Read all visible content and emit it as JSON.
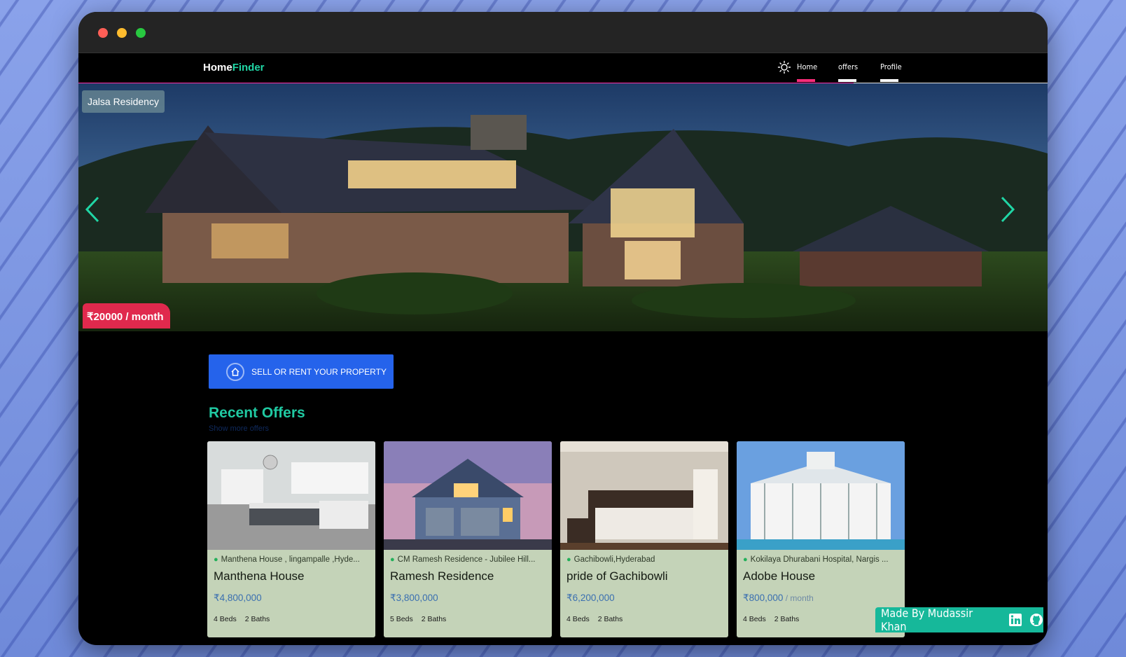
{
  "window": {
    "controls": [
      "close",
      "minimize",
      "maximize"
    ]
  },
  "brand": {
    "part1": "Home",
    "part2": "Finder"
  },
  "nav": {
    "theme_icon": "sun-icon",
    "links": [
      {
        "label": "Home",
        "underline_color": "#ff2d7a"
      },
      {
        "label": "offers",
        "underline_color": "#ffffff"
      },
      {
        "label": "Profile",
        "underline_color": "#ffffff"
      }
    ]
  },
  "hero": {
    "label": "Jalsa Residency",
    "price": "₹20000 / month"
  },
  "cta": {
    "label": "SELL OR RENT YOUR PROPERTY",
    "icon": "home-icon"
  },
  "recent": {
    "title": "Recent Offers",
    "show_more": "Show more offers",
    "cards": [
      {
        "location": "Manthena House , lingampalle ,Hyde...",
        "title": "Manthena House",
        "price": "₹4,800,000",
        "per": "",
        "beds": "4 Beds",
        "baths": "2 Baths"
      },
      {
        "location": "CM Ramesh Residence - Jubilee Hill...",
        "title": "Ramesh Residence",
        "price": "₹3,800,000",
        "per": "",
        "beds": "5 Beds",
        "baths": "2 Baths"
      },
      {
        "location": "Gachibowli,Hyderabad",
        "title": "pride of Gachibowli",
        "price": "₹6,200,000",
        "per": "",
        "beds": "4 Beds",
        "baths": "2 Baths"
      },
      {
        "location": "Kokilaya Dhurabani Hospital, Nargis ...",
        "title": "Adobe House",
        "price": "₹800,000",
        "per": " / month",
        "beds": "4 Beds",
        "baths": "2 Baths"
      }
    ]
  },
  "footer_badge": {
    "text": "Made By Mudassir Khan",
    "icons": [
      "linkedin-icon",
      "github-icon"
    ]
  },
  "colors": {
    "accent": "#20c9a2",
    "cta": "#2563eb",
    "price_tag": "#e0294d",
    "card_bg": "#c4d3b8"
  }
}
